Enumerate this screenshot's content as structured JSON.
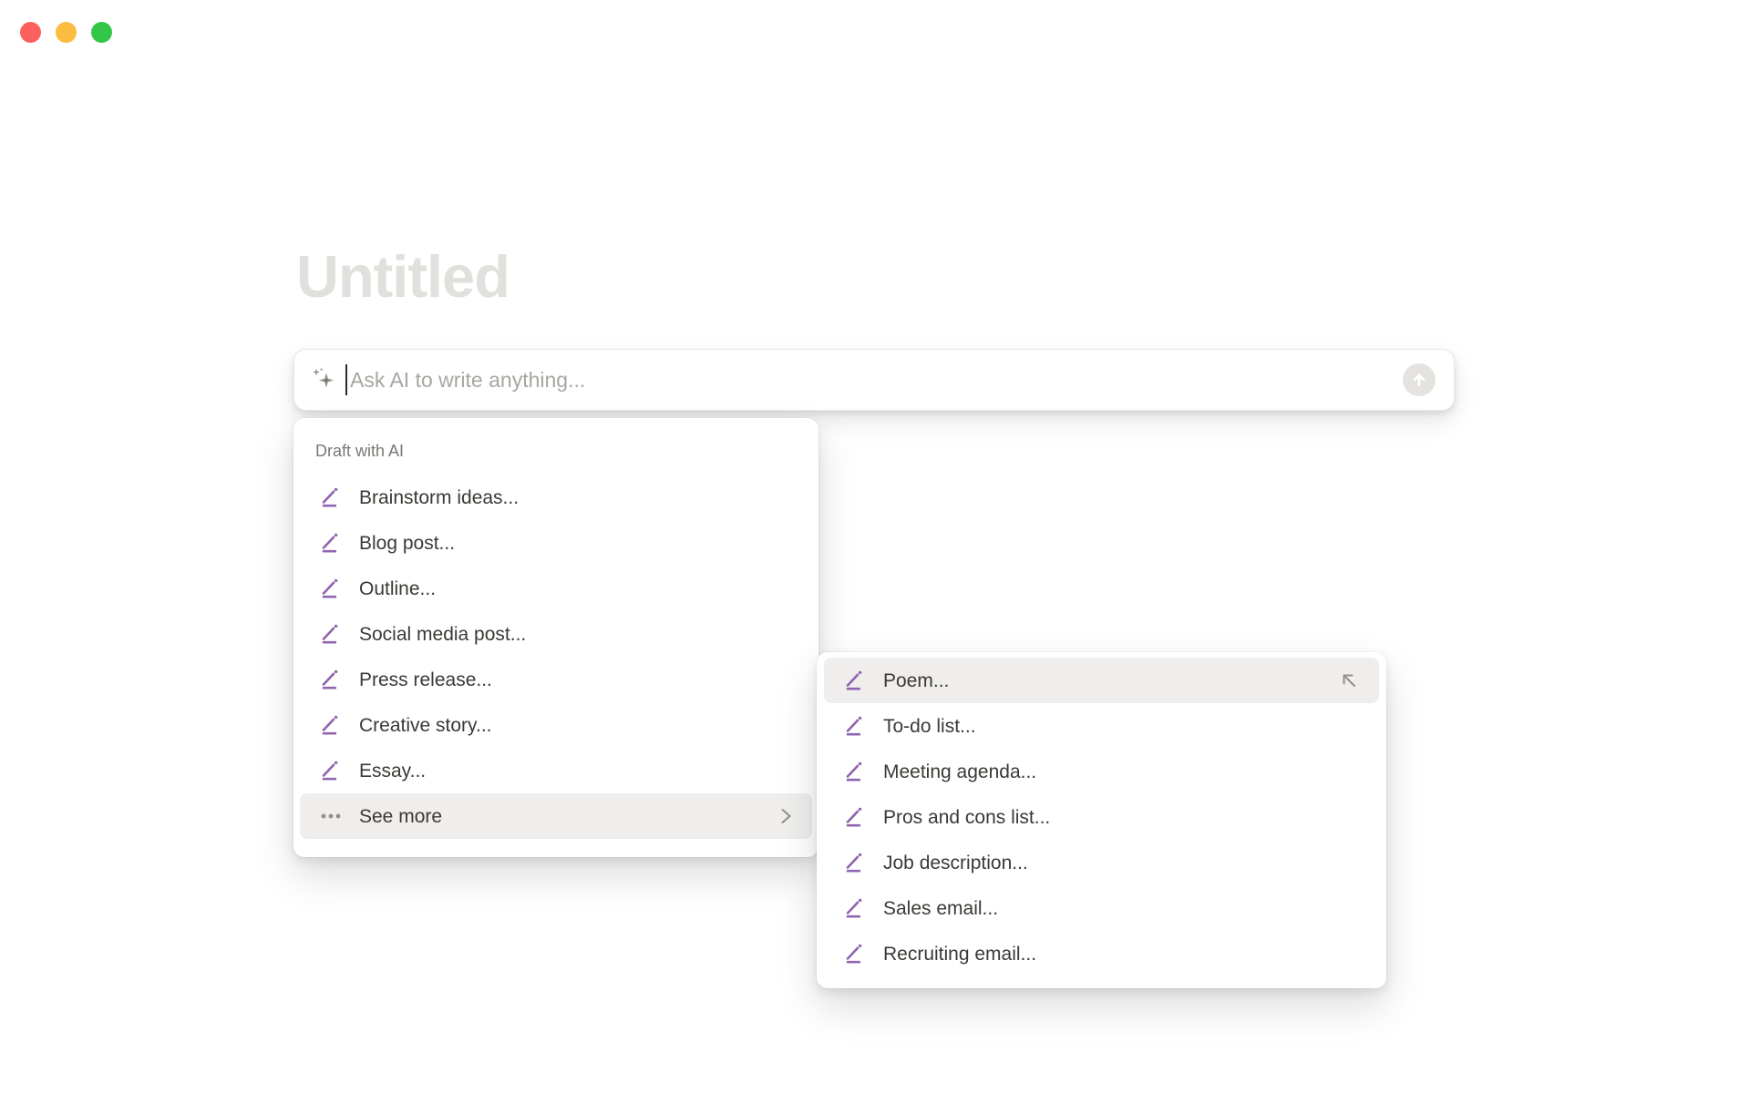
{
  "window": {
    "controls": [
      {
        "name": "close",
        "color": "#FC605C"
      },
      {
        "name": "minimize",
        "color": "#FBBC3F"
      },
      {
        "name": "zoom",
        "color": "#34C648"
      }
    ]
  },
  "page": {
    "title_placeholder": "Untitled"
  },
  "ai_bar": {
    "placeholder": "Ask AI to write anything...",
    "leading_icon": "ai-sparkle-icon",
    "submit_icon": "arrow-up-icon"
  },
  "menu": {
    "header": "Draft with AI",
    "items": [
      {
        "label": "Brainstorm ideas...",
        "icon": "pen-icon"
      },
      {
        "label": "Blog post...",
        "icon": "pen-icon"
      },
      {
        "label": "Outline...",
        "icon": "pen-icon"
      },
      {
        "label": "Social media post...",
        "icon": "pen-icon"
      },
      {
        "label": "Press release...",
        "icon": "pen-icon"
      },
      {
        "label": "Creative story...",
        "icon": "pen-icon"
      },
      {
        "label": "Essay...",
        "icon": "pen-icon"
      },
      {
        "label": "See more",
        "icon": "ellipsis-icon",
        "trailing_icon": "chevron-right-icon",
        "highlighted": true
      }
    ]
  },
  "submenu": {
    "items": [
      {
        "label": "Poem...",
        "icon": "pen-icon",
        "trailing_icon": "arrow-up-left-icon",
        "highlighted": true
      },
      {
        "label": "To-do list...",
        "icon": "pen-icon"
      },
      {
        "label": "Meeting agenda...",
        "icon": "pen-icon"
      },
      {
        "label": "Pros and cons list...",
        "icon": "pen-icon"
      },
      {
        "label": "Job description...",
        "icon": "pen-icon"
      },
      {
        "label": "Sales email...",
        "icon": "pen-icon"
      },
      {
        "label": "Recruiting email...",
        "icon": "pen-icon"
      }
    ]
  },
  "icons": {
    "ai-sparkle": "✦",
    "pen": "✎",
    "ellipsis": "•••",
    "chevron-right": "›",
    "arrow-up": "↑",
    "arrow-up-left": "↖"
  },
  "colors": {
    "accent_purple": "#9065B0",
    "menu_text": "#3B3935",
    "muted_text": "#7A7874",
    "placeholder_text": "#A9A6A1",
    "title_placeholder": "#E1E0DD",
    "highlight_bg": "#EFEEEC",
    "icon_gray": "#91908C",
    "submit_circle": "#E4E3E0"
  }
}
